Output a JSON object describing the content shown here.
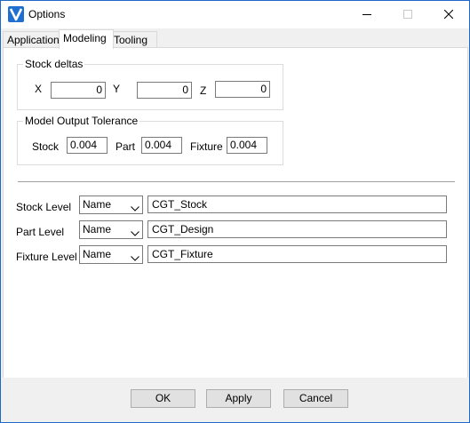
{
  "window": {
    "title": "Options",
    "minimize_icon": "minimize-icon",
    "maximize_icon": "maximize-icon",
    "close_icon": "close-icon"
  },
  "tabs": [
    {
      "label": "Application"
    },
    {
      "label": "Modeling",
      "active": true
    },
    {
      "label": "Tooling"
    }
  ],
  "stock_deltas": {
    "title": "Stock deltas",
    "x_label": "X",
    "x_value": "0",
    "y_label": "Y",
    "y_value": "0",
    "z_label": "Z",
    "z_value": "0"
  },
  "tolerance": {
    "title": "Model Output Tolerance",
    "stock_label": "Stock",
    "stock_value": "0.004",
    "part_label": "Part",
    "part_value": "0.004",
    "fixture_label": "Fixture",
    "fixture_value": "0.004"
  },
  "levels": [
    {
      "label": "Stock Level",
      "type": "Name",
      "value": "CGT_Stock"
    },
    {
      "label": "Part Level",
      "type": "Name",
      "value": "CGT_Design"
    },
    {
      "label": "Fixture Level",
      "type": "Name",
      "value": "CGT_Fixture"
    }
  ],
  "buttons": {
    "ok": "OK",
    "apply": "Apply",
    "cancel": "Cancel"
  },
  "colors": {
    "window_border": "#1e69c6",
    "app_icon": "#1f6fd0"
  }
}
